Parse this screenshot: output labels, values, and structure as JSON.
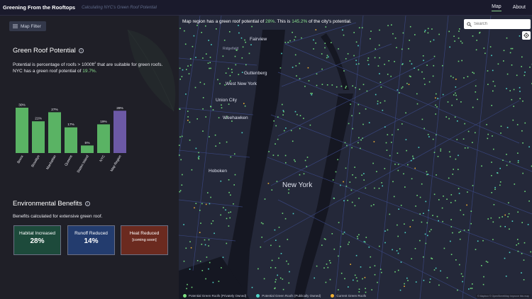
{
  "header": {
    "title": "Greening From the Rooftops",
    "subtitle": "Calculating NYC's Green Roof Potential",
    "nav": [
      {
        "label": "Map"
      },
      {
        "label": "About"
      }
    ]
  },
  "sidebar": {
    "filter_label": "Map Filter",
    "green_roof": {
      "title": "Green Roof Potential",
      "desc_part1": "Potential is percentage of roofs > 1000ft",
      "desc_sup": "2",
      "desc_part2": " that are suitable for green roofs. NYC has a green roof potential of ",
      "desc_value": "19.7%.",
      "chart_data": {
        "type": "bar",
        "categories": [
          "Bronx",
          "Brooklyn",
          "Manhattan",
          "Queens",
          "Staten Island",
          "NYC",
          "Map Region"
        ],
        "values": [
          30,
          21,
          27,
          17,
          5,
          19,
          28
        ],
        "labels": [
          "30%",
          "21%",
          "27%",
          "17%",
          "5%",
          "19%",
          "28%"
        ],
        "colors": [
          "#5ab364",
          "#5ab364",
          "#5ab364",
          "#5ab364",
          "#5ab364",
          "#5ab364",
          "#6c59a6"
        ],
        "title": "",
        "xlabel": "",
        "ylabel": "",
        "ylim": [
          0,
          30
        ]
      }
    },
    "env": {
      "title": "Environmental Benefits",
      "desc": "Benefits calculated for extensive green roof.",
      "cards": [
        {
          "label": "Habitat Increased",
          "value": "28%",
          "color": "#1d4a3b"
        },
        {
          "label": "Runoff Reduced",
          "value": "14%",
          "color": "#233c6e"
        },
        {
          "label": "Heat Reduced",
          "sub": "[coming soon]",
          "color": "#6b2a1f"
        }
      ]
    }
  },
  "map": {
    "message_pre": "Map region has a green roof potential of ",
    "message_val1": "28%",
    "message_mid": ". This is ",
    "message_val2": "145.2%",
    "message_post": " of the city's potential.",
    "search_placeholder": "Search",
    "places": {
      "fairview": "Fairview",
      "ridgefield": "Ridgefield",
      "guttenberg": "Guttenberg",
      "west_new_york": "West New York",
      "union_city": "Union City",
      "weehawken": "Weehawken",
      "hoboken": "Hoboken",
      "new_york": "New York"
    },
    "legend": [
      {
        "label": "Potential Green Roofs (Privately Owned)",
        "color": "#7ee081"
      },
      {
        "label": "Potential Green Roofs (Publically Owned)",
        "color": "#4fd6c9"
      },
      {
        "label": "Current Green Roofs",
        "color": "#f0b134"
      }
    ],
    "attribution": "© Mapbox © OpenStreetMap Improve this map"
  }
}
